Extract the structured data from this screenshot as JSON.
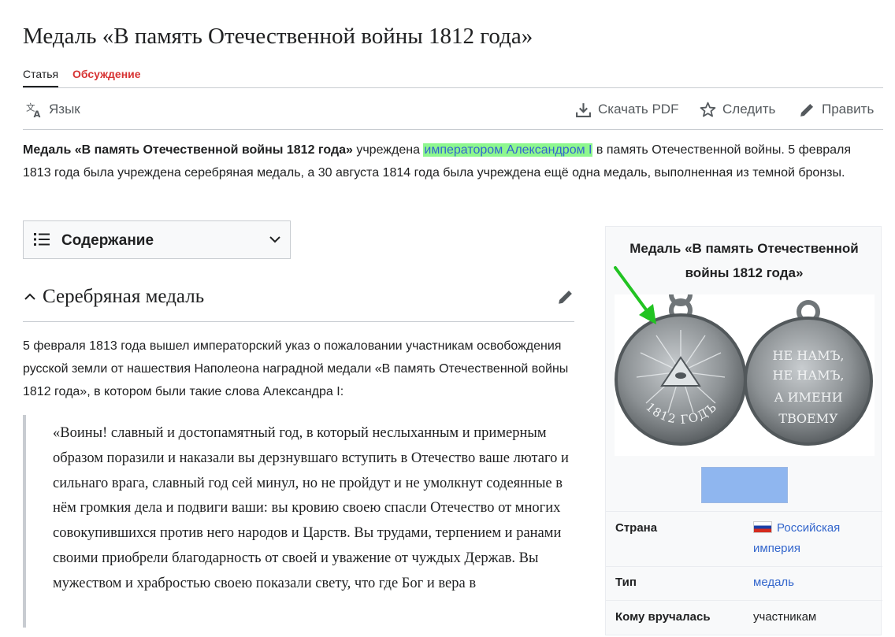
{
  "page": {
    "title": "Медаль «В память Отечественной войны 1812 года»"
  },
  "tabs": {
    "article": "Статья",
    "talk": "Обсуждение"
  },
  "toolbar": {
    "language": "Язык",
    "download_pdf": "Скачать PDF",
    "watch": "Следить",
    "edit": "Править"
  },
  "lead": {
    "bold": "Медаль «В память Отечественной войны 1812 года»",
    "t1": " учреждена ",
    "link": "императором Александром I",
    "t2": " в память Отечественной войны. 5 февраля 1813 года была учреждена серебряная медаль, а 30 августа 1814 года была учреждена ещё одна медаль, выполненная из темной бронзы."
  },
  "toc": {
    "label": "Содержание"
  },
  "section": {
    "heading": "Серебряная медаль",
    "paragraph": "5 февраля 1813 года вышел императорский указ о пожаловании участникам освобождения русской земли от нашествия Наполеона наградной медали «В память Отечественной войны 1812 года», в котором были такие слова Александра I:",
    "quote": "«Воины! славный и достопамятный год, в который неслыханным и примерным образом поразили и наказали вы дерзнувшаго вступить в Отечество ваше лютаго и сильнаго врага, славный год сей минул, но не пройдут и не умолкнут содеянные в нём громкия дела и подвиги ваши: вы кровию своею спасли Отечество от многих совокупившихся против него народов и Царств. Вы трудами, терпением и ранами своими приобрели благодарность от своей и уважение от чуждых Держав. Вы мужеством и храбростью своею показали свету, что где Бог и вера в"
  },
  "infobox": {
    "title": "Медаль «В память Отечественной войны 1812 года»",
    "medal_obverse_text": "1812 ГОДЪ",
    "medal_reverse_lines": [
      "НЕ НАМЪ,",
      "НЕ НАМЪ,",
      "А ИМЕНИ",
      "ТВОЕМУ"
    ],
    "rows": [
      {
        "label": "Страна",
        "value": "Российская империя"
      },
      {
        "label": "Тип",
        "value": "медаль"
      },
      {
        "label": "Кому вручалась",
        "value": "участникам"
      }
    ]
  },
  "colors": {
    "link": "#3366cc",
    "highlight": "#8ef78e",
    "talk_tab": "#d73333",
    "arrow": "#22c322",
    "ribbon": "#8fb6ef"
  },
  "icons": [
    "translate-icon",
    "download-icon",
    "star-icon",
    "pencil-icon",
    "list-icon",
    "chevron-down-icon",
    "chevron-up-icon",
    "arrow-icon",
    "flag-russia-icon"
  ]
}
